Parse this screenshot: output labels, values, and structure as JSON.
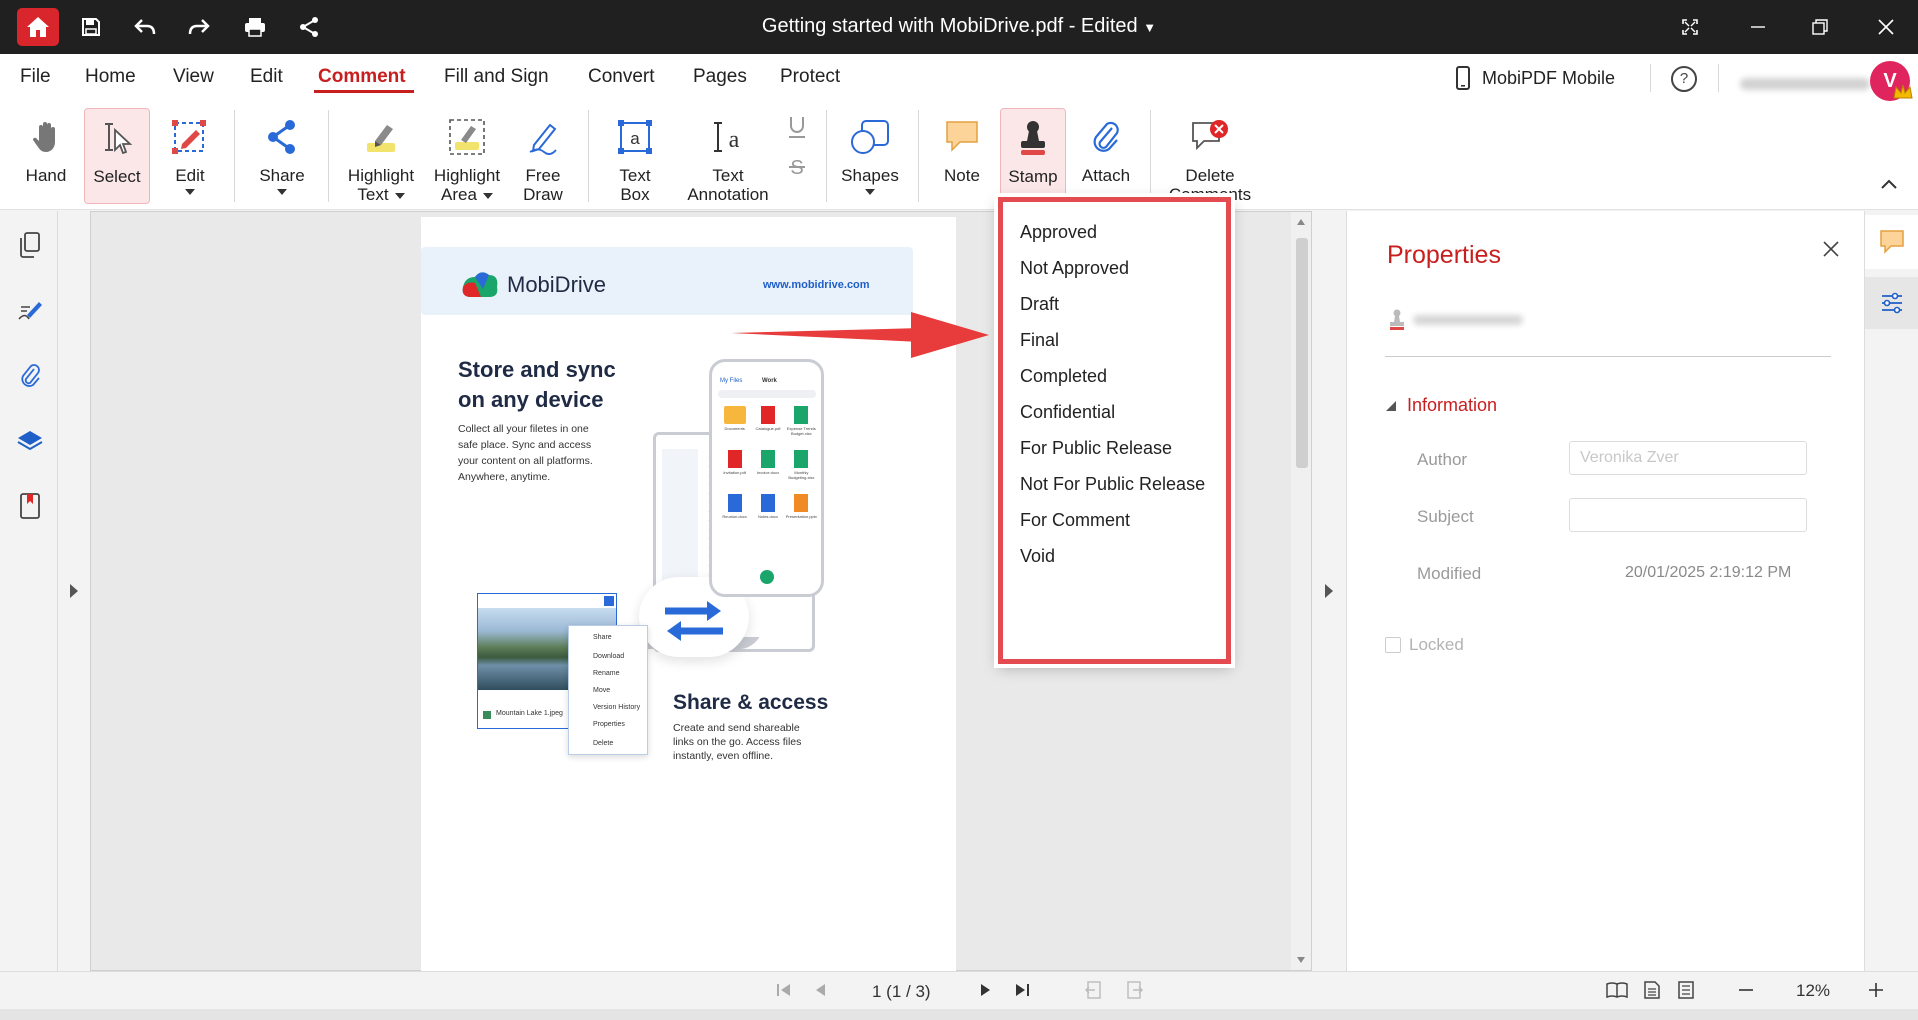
{
  "window": {
    "title": "Getting started with MobiDrive.pdf - Edited"
  },
  "menu": {
    "items": [
      "File",
      "Home",
      "View",
      "Edit",
      "Comment",
      "Fill and Sign",
      "Convert",
      "Pages",
      "Protect"
    ],
    "active": "Comment"
  },
  "mobile_link": "MobiPDF Mobile",
  "avatar": {
    "initial": "V"
  },
  "toolbar": {
    "hand": "Hand",
    "select": "Select",
    "edit": "Edit",
    "share": "Share",
    "highlight_text_1": "Highlight",
    "highlight_text_2": "Text",
    "highlight_area_1": "Highlight",
    "highlight_area_2": "Area",
    "free_draw_1": "Free",
    "free_draw_2": "Draw",
    "text_box_1": "Text",
    "text_box_2": "Box",
    "text_annotation_1": "Text",
    "text_annotation_2": "Annotation",
    "shapes": "Shapes",
    "note": "Note",
    "stamp": "Stamp",
    "attach": "Attach",
    "delete_comments_1": "Delete",
    "delete_comments_2": "Comments"
  },
  "stamp_menu": [
    "Approved",
    "Not Approved",
    "Draft",
    "Final",
    "Completed",
    "Confidential",
    "For Public Release",
    "Not For Public Release",
    "For Comment",
    "Void"
  ],
  "document": {
    "logo_text": "MobiDrive",
    "url": "www.mobidrive.com",
    "h1_line1": "Store and sync",
    "h1_line2": "on any device",
    "p1": [
      "Collect all your filetes in one",
      "safe place. Sync and access",
      "your content on all platforms.",
      "Anywhere, anytime."
    ],
    "h2": "Share & access",
    "p2": [
      "Create and send shareable",
      "links on the go. Access files",
      "instantly, even offline."
    ],
    "context_menu": [
      "Share",
      "Download",
      "Rename",
      "Move",
      "Version History",
      "Properties",
      "Delete"
    ],
    "photo_caption": "Mountain Lake 1.jpeg",
    "phone_header": "My Files",
    "phone_tab": "Work",
    "phone_files": [
      "Documents",
      "Catalogue.pdf",
      "Expense Trends Budget.xlsx",
      "Invitation.pdf",
      "Invoice.docx",
      "Monthly Budgeting.xlsx",
      "Reunion.docx",
      "Notes.docx",
      "Presentation.pptx"
    ]
  },
  "properties": {
    "title": "Properties",
    "section": "Information",
    "author_label": "Author",
    "author_value": "Veronika Zver",
    "subject_label": "Subject",
    "modified_label": "Modified",
    "modified_value": "20/01/2025 2:19:12 PM",
    "locked_label": "Locked"
  },
  "status": {
    "page": "1 (1 / 3)",
    "zoom": "12%"
  },
  "colors": {
    "accent": "#c81e1e",
    "titlebar": "#202020",
    "dropdown_border": "#e34b50",
    "selected_bg": "#fbe7e8"
  }
}
